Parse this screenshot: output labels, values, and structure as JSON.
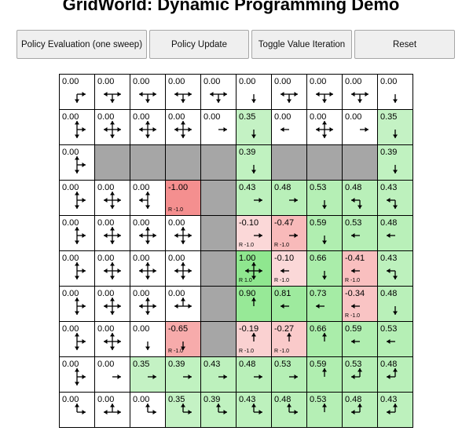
{
  "title": "GridWorld: Dynamic Programming Demo",
  "buttons": [
    {
      "name": "policy-evaluation-button",
      "label": "Policy Evaluation (one sweep)"
    },
    {
      "name": "policy-update-button",
      "label": "Policy Update"
    },
    {
      "name": "toggle-value-iteration-button",
      "label": "Toggle Value Iteration"
    },
    {
      "name": "reset-button",
      "label": "Reset"
    }
  ],
  "colors": {
    "wall": "#a6a6a6",
    "positive": "#00c800",
    "negative": "#e60000",
    "arrow": "#000000"
  },
  "grid": {
    "rows": 10,
    "cols": 10,
    "cells": [
      [
        {
          "v": "0.00",
          "a": "RD"
        },
        {
          "v": "0.00",
          "a": "LRD"
        },
        {
          "v": "0.00",
          "a": "LRD"
        },
        {
          "v": "0.00",
          "a": "LRD"
        },
        {
          "v": "0.00",
          "a": "LRD"
        },
        {
          "v": "0.00",
          "a": "D"
        },
        {
          "v": "0.00",
          "a": "LRD"
        },
        {
          "v": "0.00",
          "a": "LRD"
        },
        {
          "v": "0.00",
          "a": "LRD"
        },
        {
          "v": "0.00",
          "a": "D"
        }
      ],
      [
        {
          "v": "0.00",
          "a": "URD"
        },
        {
          "v": "0.00",
          "a": "ULRD"
        },
        {
          "v": "0.00",
          "a": "ULRD"
        },
        {
          "v": "0.00",
          "a": "ULRD"
        },
        {
          "v": "0.00",
          "a": "R"
        },
        {
          "v": "0.35",
          "a": "D"
        },
        {
          "v": "0.00",
          "a": "L"
        },
        {
          "v": "0.00",
          "a": "ULRD"
        },
        {
          "v": "0.00",
          "a": "R"
        },
        {
          "v": "0.35",
          "a": "D"
        }
      ],
      [
        {
          "v": "0.00",
          "a": "URD"
        },
        {
          "w": true
        },
        {
          "w": true
        },
        {
          "w": true
        },
        {
          "w": true
        },
        {
          "v": "0.39",
          "a": "D"
        },
        {
          "w": true
        },
        {
          "w": true
        },
        {
          "w": true
        },
        {
          "v": "0.39",
          "a": "D"
        }
      ],
      [
        {
          "v": "0.00",
          "a": "URD"
        },
        {
          "v": "0.00",
          "a": "ULRD"
        },
        {
          "v": "0.00",
          "a": "ULD"
        },
        {
          "v": "-1.00",
          "r": "R -1.0"
        },
        {
          "w": true
        },
        {
          "v": "0.43",
          "a": "R"
        },
        {
          "v": "0.48",
          "a": "R"
        },
        {
          "v": "0.53",
          "a": "D"
        },
        {
          "v": "0.48",
          "a": "LD"
        },
        {
          "v": "0.43",
          "a": "LD"
        }
      ],
      [
        {
          "v": "0.00",
          "a": "URD"
        },
        {
          "v": "0.00",
          "a": "ULRD"
        },
        {
          "v": "0.00",
          "a": "ULRD"
        },
        {
          "v": "0.00",
          "a": "ULRD"
        },
        {
          "w": true
        },
        {
          "v": "-0.10",
          "a": "R",
          "r": "R -1.0"
        },
        {
          "v": "-0.47",
          "a": "R",
          "r": "R -1.0"
        },
        {
          "v": "0.59",
          "a": "D"
        },
        {
          "v": "0.53",
          "a": "L"
        },
        {
          "v": "0.48",
          "a": "L"
        }
      ],
      [
        {
          "v": "0.00",
          "a": "URD"
        },
        {
          "v": "0.00",
          "a": "ULRD"
        },
        {
          "v": "0.00",
          "a": "ULRD"
        },
        {
          "v": "0.00",
          "a": "ULRD"
        },
        {
          "w": true
        },
        {
          "v": "1.00",
          "a": "ULRD",
          "r": "R 1.0"
        },
        {
          "v": "-0.10",
          "a": "L",
          "r": "R -1.0"
        },
        {
          "v": "0.66",
          "a": "D"
        },
        {
          "v": "-0.41",
          "a": "L",
          "r": "R -1.0"
        },
        {
          "v": "0.43",
          "a": "LD"
        }
      ],
      [
        {
          "v": "0.00",
          "a": "URD"
        },
        {
          "v": "0.00",
          "a": "ULRD"
        },
        {
          "v": "0.00",
          "a": "ULRD"
        },
        {
          "v": "0.00",
          "a": "ULR"
        },
        {
          "w": true
        },
        {
          "v": "0.90",
          "a": "U"
        },
        {
          "v": "0.81",
          "a": "L"
        },
        {
          "v": "0.73",
          "a": "L"
        },
        {
          "v": "-0.34",
          "a": "L",
          "r": "R -1.0"
        },
        {
          "v": "0.48",
          "a": "D"
        }
      ],
      [
        {
          "v": "0.00",
          "a": "URD"
        },
        {
          "v": "0.00",
          "a": "ULRD"
        },
        {
          "v": "0.00",
          "a": "D"
        },
        {
          "v": "-0.65",
          "a": "D",
          "r": "R -1.0"
        },
        {
          "w": true
        },
        {
          "v": "-0.19",
          "a": "U",
          "r": "R -1.0"
        },
        {
          "v": "-0.27",
          "a": "U",
          "r": "R -1.0"
        },
        {
          "v": "0.66",
          "a": "U"
        },
        {
          "v": "0.59",
          "a": "L"
        },
        {
          "v": "0.53",
          "a": "L"
        }
      ],
      [
        {
          "v": "0.00",
          "a": "URD"
        },
        {
          "v": "0.00",
          "a": "R"
        },
        {
          "v": "0.35",
          "a": "R"
        },
        {
          "v": "0.39",
          "a": "R"
        },
        {
          "v": "0.43",
          "a": "R"
        },
        {
          "v": "0.48",
          "a": "R"
        },
        {
          "v": "0.53",
          "a": "R"
        },
        {
          "v": "0.59",
          "a": "U"
        },
        {
          "v": "0.53",
          "a": "UL"
        },
        {
          "v": "0.48",
          "a": "UL"
        }
      ],
      [
        {
          "v": "0.00",
          "a": "UR"
        },
        {
          "v": "0.00",
          "a": "ULR"
        },
        {
          "v": "0.00",
          "a": "UR"
        },
        {
          "v": "0.35",
          "a": "UR"
        },
        {
          "v": "0.39",
          "a": "UR"
        },
        {
          "v": "0.43",
          "a": "UR"
        },
        {
          "v": "0.48",
          "a": "UR"
        },
        {
          "v": "0.53",
          "a": "U"
        },
        {
          "v": "0.48",
          "a": "UL"
        },
        {
          "v": "0.43",
          "a": "UL"
        }
      ]
    ]
  }
}
